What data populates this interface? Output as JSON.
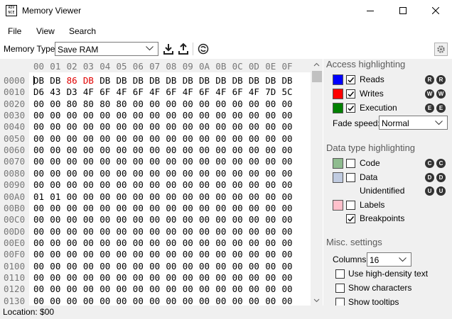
{
  "window": {
    "title": "Memory Viewer",
    "icon_text": "ADV NCE"
  },
  "menu": [
    "File",
    "View",
    "Search"
  ],
  "toolbar": {
    "memory_type_label": "Memory Type:",
    "memory_type_value": "Save RAM",
    "icons": [
      "import-icon",
      "export-icon",
      "refresh-icon"
    ]
  },
  "hex": {
    "columns": [
      "00",
      "01",
      "02",
      "03",
      "04",
      "05",
      "06",
      "07",
      "08",
      "09",
      "0A",
      "0B",
      "0C",
      "0D",
      "0E",
      "0F"
    ],
    "rows": [
      {
        "addr": "0000",
        "bytes": [
          "DB",
          "DB",
          "86",
          "DB",
          "DB",
          "DB",
          "DB",
          "DB",
          "DB",
          "DB",
          "DB",
          "DB",
          "DB",
          "DB",
          "DB",
          "DB"
        ],
        "red": [
          2,
          3
        ]
      },
      {
        "addr": "0010",
        "bytes": [
          "D6",
          "43",
          "D3",
          "4F",
          "6F",
          "4F",
          "6F",
          "4F",
          "6F",
          "4F",
          "6F",
          "4F",
          "6F",
          "4F",
          "7D",
          "5C"
        ]
      },
      {
        "addr": "0020",
        "bytes": [
          "00",
          "00",
          "80",
          "80",
          "80",
          "80",
          "00",
          "00",
          "00",
          "00",
          "00",
          "00",
          "00",
          "00",
          "00",
          "00"
        ]
      },
      {
        "addr": "0030",
        "bytes": [
          "00",
          "00",
          "00",
          "00",
          "00",
          "00",
          "00",
          "00",
          "00",
          "00",
          "00",
          "00",
          "00",
          "00",
          "00",
          "00"
        ]
      },
      {
        "addr": "0040",
        "bytes": [
          "00",
          "00",
          "00",
          "00",
          "00",
          "00",
          "00",
          "00",
          "00",
          "00",
          "00",
          "00",
          "00",
          "00",
          "00",
          "00"
        ]
      },
      {
        "addr": "0050",
        "bytes": [
          "00",
          "00",
          "00",
          "00",
          "00",
          "00",
          "00",
          "00",
          "00",
          "00",
          "00",
          "00",
          "00",
          "00",
          "00",
          "00"
        ]
      },
      {
        "addr": "0060",
        "bytes": [
          "00",
          "00",
          "00",
          "00",
          "00",
          "00",
          "00",
          "00",
          "00",
          "00",
          "00",
          "00",
          "00",
          "00",
          "00",
          "00"
        ]
      },
      {
        "addr": "0070",
        "bytes": [
          "00",
          "00",
          "00",
          "00",
          "00",
          "00",
          "00",
          "00",
          "00",
          "00",
          "00",
          "00",
          "00",
          "00",
          "00",
          "00"
        ]
      },
      {
        "addr": "0080",
        "bytes": [
          "00",
          "00",
          "00",
          "00",
          "00",
          "00",
          "00",
          "00",
          "00",
          "00",
          "00",
          "00",
          "00",
          "00",
          "00",
          "00"
        ]
      },
      {
        "addr": "0090",
        "bytes": [
          "00",
          "00",
          "00",
          "00",
          "00",
          "00",
          "00",
          "00",
          "00",
          "00",
          "00",
          "00",
          "00",
          "00",
          "00",
          "00"
        ]
      },
      {
        "addr": "00A0",
        "bytes": [
          "01",
          "01",
          "00",
          "00",
          "00",
          "00",
          "00",
          "00",
          "00",
          "00",
          "00",
          "00",
          "00",
          "00",
          "00",
          "00"
        ]
      },
      {
        "addr": "00B0",
        "bytes": [
          "00",
          "00",
          "00",
          "00",
          "00",
          "00",
          "00",
          "00",
          "00",
          "00",
          "00",
          "00",
          "00",
          "00",
          "00",
          "00"
        ]
      },
      {
        "addr": "00C0",
        "bytes": [
          "00",
          "00",
          "00",
          "00",
          "00",
          "00",
          "00",
          "00",
          "00",
          "00",
          "00",
          "00",
          "00",
          "00",
          "00",
          "00"
        ]
      },
      {
        "addr": "00D0",
        "bytes": [
          "00",
          "00",
          "00",
          "00",
          "00",
          "00",
          "00",
          "00",
          "00",
          "00",
          "00",
          "00",
          "00",
          "00",
          "00",
          "00"
        ]
      },
      {
        "addr": "00E0",
        "bytes": [
          "00",
          "00",
          "00",
          "00",
          "00",
          "00",
          "00",
          "00",
          "00",
          "00",
          "00",
          "00",
          "00",
          "00",
          "00",
          "00"
        ]
      },
      {
        "addr": "00F0",
        "bytes": [
          "00",
          "00",
          "00",
          "00",
          "00",
          "00",
          "00",
          "00",
          "00",
          "00",
          "00",
          "00",
          "00",
          "00",
          "00",
          "00"
        ]
      },
      {
        "addr": "0100",
        "bytes": [
          "00",
          "00",
          "00",
          "00",
          "00",
          "00",
          "00",
          "00",
          "00",
          "00",
          "00",
          "00",
          "00",
          "00",
          "00",
          "00"
        ]
      },
      {
        "addr": "0110",
        "bytes": [
          "00",
          "00",
          "00",
          "00",
          "00",
          "00",
          "00",
          "00",
          "00",
          "00",
          "00",
          "00",
          "00",
          "00",
          "00",
          "00"
        ]
      },
      {
        "addr": "0120",
        "bytes": [
          "00",
          "00",
          "00",
          "00",
          "00",
          "00",
          "00",
          "00",
          "00",
          "00",
          "00",
          "00",
          "00",
          "00",
          "00",
          "00"
        ]
      },
      {
        "addr": "0130",
        "bytes": [
          "00",
          "00",
          "00",
          "00",
          "00",
          "00",
          "00",
          "00",
          "00",
          "00",
          "00",
          "00",
          "00",
          "00",
          "00",
          "00"
        ]
      }
    ]
  },
  "panel": {
    "access": {
      "title": "Access highlighting",
      "items": [
        {
          "label": "Reads",
          "color": "#0000ff",
          "checked": true,
          "badges": [
            "R",
            "R"
          ]
        },
        {
          "label": "Writes",
          "color": "#ff0000",
          "checked": true,
          "badges": [
            "W",
            "W"
          ]
        },
        {
          "label": "Execution",
          "color": "#008000",
          "checked": true,
          "badges": [
            "E",
            "E"
          ]
        }
      ],
      "fade_label": "Fade speed:",
      "fade_value": "Normal"
    },
    "datatype": {
      "title": "Data type highlighting",
      "items": [
        {
          "label": "Code",
          "color": "#8fbc8f",
          "checked": false,
          "badges": [
            "C",
            "C"
          ]
        },
        {
          "label": "Data",
          "color": "#c0cbe0",
          "checked": false,
          "badges": [
            "D",
            "D"
          ]
        },
        {
          "label": "Unidentified",
          "color": "",
          "checked": null,
          "badges": [
            "U",
            "U"
          ]
        },
        {
          "label": "Labels",
          "color": "#ffc0cb",
          "checked": false,
          "badges": []
        },
        {
          "label": "Breakpoints",
          "color": "",
          "checked": true,
          "badges": []
        }
      ]
    },
    "misc": {
      "title": "Misc. settings",
      "columns_label": "Columns:",
      "columns_value": "16",
      "options": [
        {
          "label": "Use high-density text",
          "checked": false
        },
        {
          "label": "Show characters",
          "checked": false
        },
        {
          "label": "Show tooltips",
          "checked": false
        }
      ]
    }
  },
  "status": {
    "location": "Location: $00"
  }
}
